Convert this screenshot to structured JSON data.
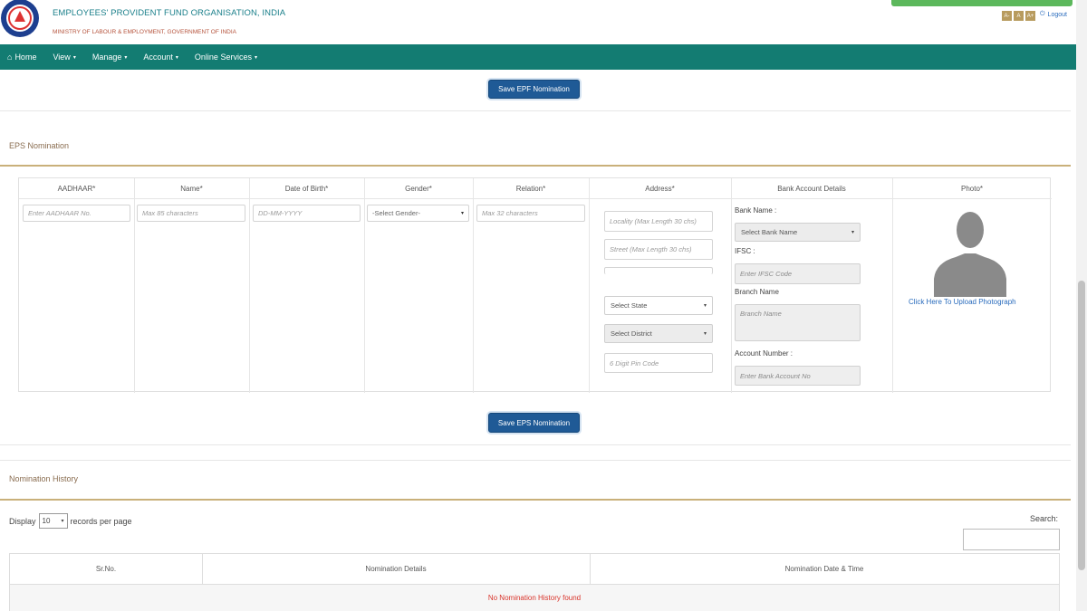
{
  "header": {
    "title": "EMPLOYEES' PROVIDENT FUND ORGANISATION, INDIA",
    "subtitle": "MINISTRY OF LABOUR & EMPLOYMENT, GOVERNMENT OF INDIA",
    "font_buttons": [
      "A-",
      "A",
      "A+"
    ],
    "logout": "Logout"
  },
  "nav": {
    "home": "Home",
    "view": "View",
    "manage": "Manage",
    "account": "Account",
    "online_services": "Online Services"
  },
  "epf": {
    "save_button": "Save EPF Nomination"
  },
  "eps": {
    "section_title": "EPS Nomination",
    "headers": {
      "aadhaar": "AADHAAR*",
      "name": "Name*",
      "dob": "Date of Birth*",
      "gender": "Gender*",
      "relation": "Relation*",
      "address": "Address*",
      "bank": "Bank Account Details",
      "photo": "Photo*"
    },
    "placeholders": {
      "aadhaar": "Enter AADHAAR No.",
      "name": "Max 85 characters",
      "dob": "DD-MM-YYYY",
      "relation": "Max 32 characters",
      "locality": "Locality (Max Length 30 chs)",
      "street": "Street (Max Length 30 chs)",
      "pin": "6 Digit Pin Code",
      "ifsc": "Enter IFSC Code",
      "branch": "Branch Name",
      "account": "Enter Bank Account No"
    },
    "gender_select": "-Select Gender-",
    "state_select": "Select State",
    "district_select": "Select District",
    "bank_select": "Select Bank Name",
    "labels": {
      "bank_name": "Bank Name :",
      "ifsc": "IFSC :",
      "branch": "Branch Name",
      "account": "Account Number :"
    },
    "photo_link": "Click Here To Upload Photograph",
    "save_button": "Save EPS Nomination"
  },
  "history": {
    "section_title": "Nomination History",
    "display_label": "Display",
    "records_value": "10",
    "records_suffix": "records per page",
    "search_label": "Search:",
    "columns": [
      "Sr.No.",
      "Nomination Details",
      "Nomination Date & Time"
    ],
    "empty_message": "No Nomination History found"
  },
  "colors": {
    "nav_bg": "#137c72",
    "button_bg": "#1f5a96",
    "section_rule": "#c9b07a",
    "error_text": "#d9342b"
  }
}
